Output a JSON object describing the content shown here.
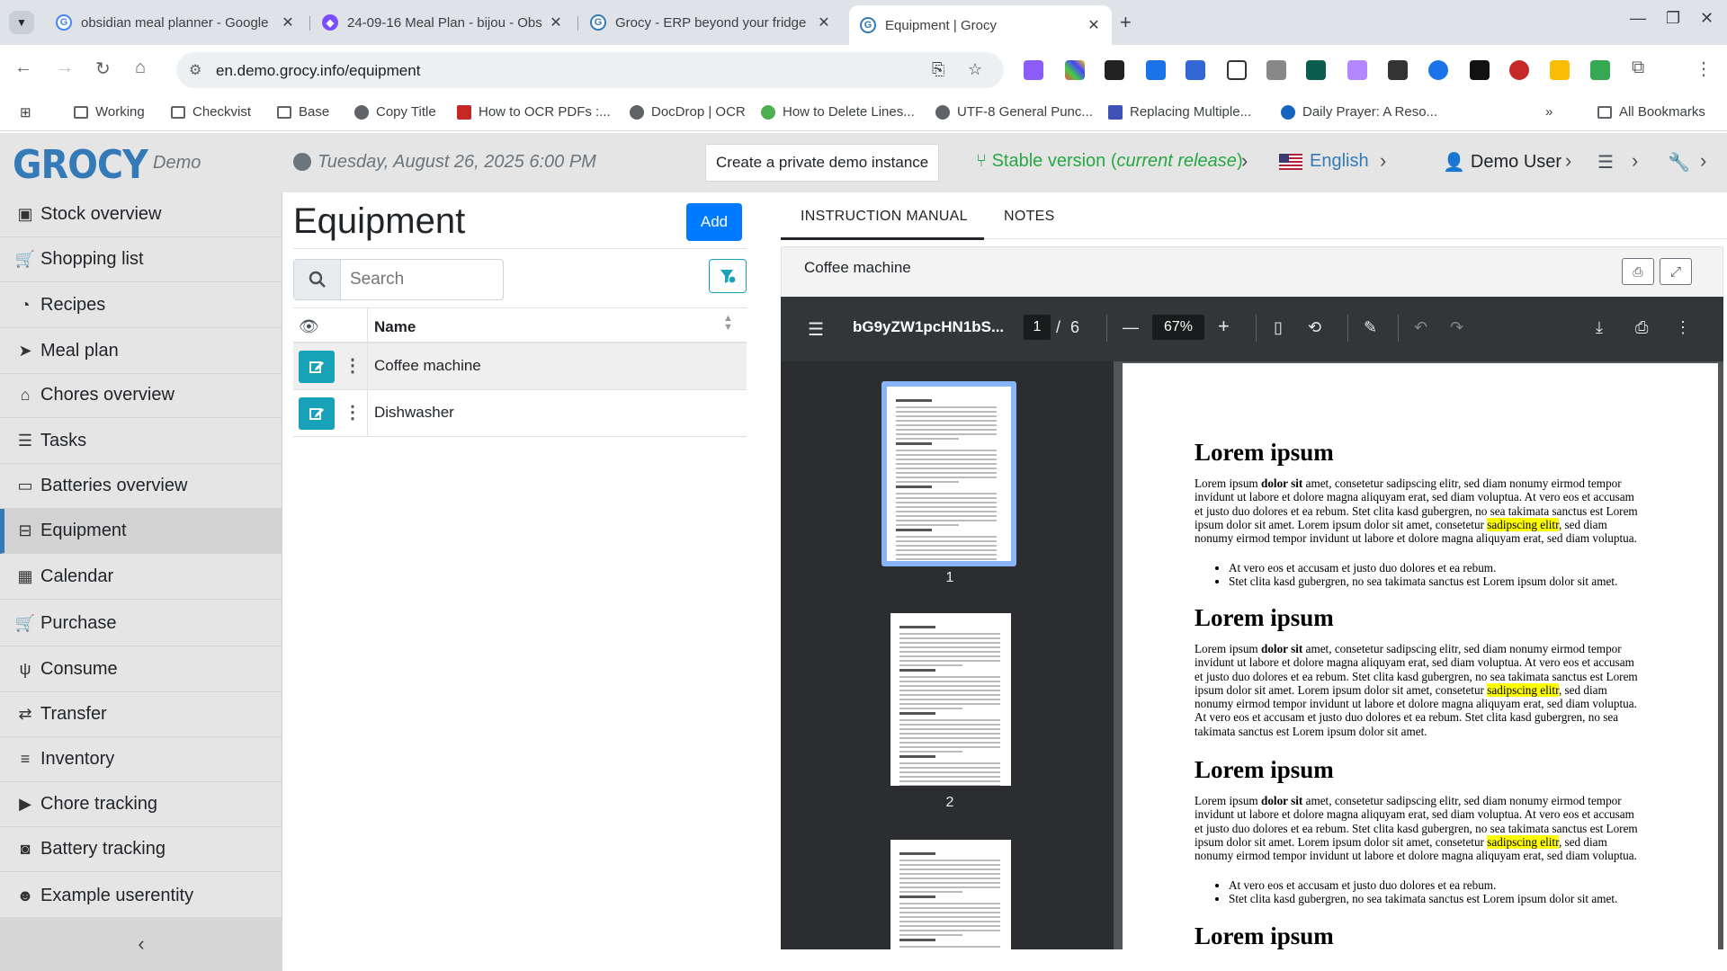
{
  "browser": {
    "tabs": [
      {
        "title": "obsidian meal planner - Google",
        "active": false
      },
      {
        "title": "24-09-16 Meal Plan - bijou - Obs",
        "active": false
      },
      {
        "title": "Grocy - ERP beyond your fridge",
        "active": false
      },
      {
        "title": "Equipment | Grocy",
        "active": true
      }
    ],
    "url": "en.demo.grocy.info/equipment",
    "bookmarks": [
      "Working",
      "Checkvist",
      "Base",
      "Copy Title",
      "How to OCR PDFs :...",
      "DocDrop | OCR",
      "How to Delete Lines...",
      "UTF-8 General Punc...",
      "Replacing Multiple...",
      "Daily Prayer: A Reso..."
    ],
    "all_bookmarks": "All Bookmarks"
  },
  "header": {
    "logo": "GROCY",
    "logo_sub": "Demo",
    "datetime": "Tuesday, August 26, 2025 6:00 PM",
    "demo_button": "Create a private demo instance",
    "version_label": "Stable version (",
    "version_italic": "current release",
    "version_close": ")",
    "language": "English",
    "user": "Demo User"
  },
  "sidebar": {
    "items": [
      {
        "label": "Stock overview",
        "icon": "box-icon"
      },
      {
        "label": "Shopping list",
        "icon": "cart-icon"
      },
      {
        "label": "Recipes",
        "icon": "pizza-icon"
      },
      {
        "label": "Meal plan",
        "icon": "paper-plane-icon"
      },
      {
        "label": "Chores overview",
        "icon": "home-icon"
      },
      {
        "label": "Tasks",
        "icon": "tasks-icon"
      },
      {
        "label": "Batteries overview",
        "icon": "battery-icon"
      },
      {
        "label": "Equipment",
        "icon": "toolbox-icon",
        "active": true
      },
      {
        "label": "Calendar",
        "icon": "calendar-icon"
      },
      {
        "label": "Purchase",
        "icon": "cart-plus-icon"
      },
      {
        "label": "Consume",
        "icon": "utensils-icon"
      },
      {
        "label": "Transfer",
        "icon": "exchange-icon"
      },
      {
        "label": "Inventory",
        "icon": "list-icon"
      },
      {
        "label": "Chore tracking",
        "icon": "play-icon"
      },
      {
        "label": "Battery tracking",
        "icon": "car-battery-icon"
      },
      {
        "label": "Example userentity",
        "icon": "smile-icon"
      }
    ]
  },
  "equipment": {
    "title": "Equipment",
    "add_label": "Add",
    "search_placeholder": "Search",
    "column_name": "Name",
    "rows": [
      "Coffee machine",
      "Dishwasher"
    ]
  },
  "detail": {
    "tabs": [
      "INSTRUCTION MANUAL",
      "NOTES"
    ],
    "card_title": "Coffee machine",
    "pdf": {
      "filename": "bG9yZW1pcHN1bS...",
      "current_page": "1",
      "total_pages": "6",
      "page_sep": "/",
      "zoom": "67%",
      "thumb_labels": [
        "1",
        "2"
      ],
      "heading": "Lorem ipsum",
      "para_a1": "Lorem ipsum ",
      "para_bold": "dolor sit",
      "para_a2": " amet, consetetur sadipscing elitr, sed diam nonumy eirmod tempor invidunt ut labore et dolore magna aliquyam erat, sed diam voluptua. At vero eos et accusam et justo duo dolores et ea rebum. Stet clita kasd gubergren, no sea takimata sanctus est Lorem ipsum dolor sit amet. Lorem ipsum dolor sit amet, consetetur ",
      "para_mark": "sadipscing elitr",
      "para_a3": ", sed diam nonumy eirmod tempor invidunt ut labore et dolore magna aliquyam erat, sed diam voluptua.",
      "para_b_extra": " At vero eos et accusam et justo duo dolores et ea rebum. Stet clita kasd gubergren, no sea takimata sanctus est Lorem ipsum dolor sit amet.",
      "bullet1": "At vero eos et accusam et justo duo dolores et ea rebum.",
      "bullet2": "Stet clita kasd gubergren, no sea takimata sanctus est Lorem ipsum dolor sit amet."
    }
  },
  "colors": {
    "accent": "#337ab7",
    "add_button": "#007bff",
    "edit_button": "#17a2b8",
    "version": "#28a745"
  }
}
